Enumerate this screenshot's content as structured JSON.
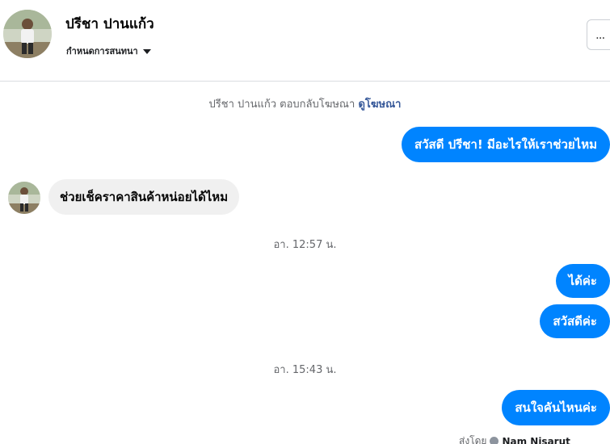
{
  "header": {
    "contact_name": "ปรีชา ปานแก้ว",
    "conversation_settings": "กำหนดการสนทนา",
    "more_label": "..."
  },
  "thread": {
    "reply_note_prefix": "ปรีชา ปานแก้ว ตอบกลับโฆษณา",
    "reply_note_link": "ดูโฆษณา",
    "messages": [
      {
        "from": "page",
        "text": "สวัสดี ปรีชา! มีอะไรให้เราช่วยไหม"
      },
      {
        "from": "contact",
        "text": "ช่วยเช็คราคาสินค้าหน่อยได้ไหม"
      },
      {
        "from": "page",
        "text": "ได้ค่ะ"
      },
      {
        "from": "page",
        "text": "สวัสดีค่ะ"
      },
      {
        "from": "page",
        "text": "สนใจคันไหนค่ะ"
      }
    ],
    "timestamps": [
      "อา. 12:57 น.",
      "อา. 15:43 น."
    ],
    "sent_by_prefix": "ส่งโดย",
    "sent_by_name": "Nam Nisarut"
  },
  "colors": {
    "outgoing_bubble": "#0084ff",
    "incoming_bubble": "#f0f0f0",
    "link": "#365899"
  },
  "icons": {
    "contact_avatar": "person-photo",
    "settings_caret": "caret-down-icon",
    "more": "ellipsis-icon",
    "sent_check": "check-circle-icon"
  }
}
